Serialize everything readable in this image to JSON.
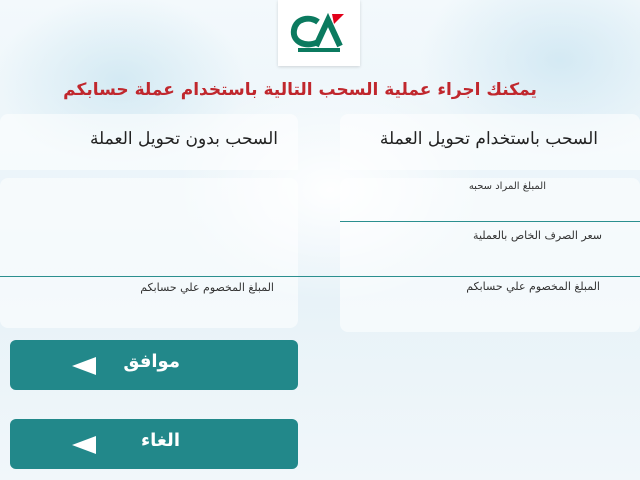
{
  "header": {
    "logo_name": "credit-agricole-logo",
    "message": "يمكنك اجراء عملية السحب التالية باستخدام عملة حسابكم"
  },
  "left_panel": {
    "title": "السحب بدون تحويل العملة",
    "debited_label": "المبلغ المخصوم علي حسابكم"
  },
  "right_panel": {
    "title": "السحب باستخدام تحويل العملة",
    "withdraw_amount_label": "المبلغ المراد سحبه",
    "exchange_rate_label": "سعر الصرف الخاص بالعملية",
    "debited_label": "المبلغ المخصوم علي حسابكم"
  },
  "buttons": {
    "confirm_label": "موافق",
    "cancel_label": "الغاء"
  },
  "colors": {
    "accent": "#22888a",
    "headline": "#c0272d",
    "logo_green": "#0b7a5f",
    "logo_red": "#e2001a"
  }
}
